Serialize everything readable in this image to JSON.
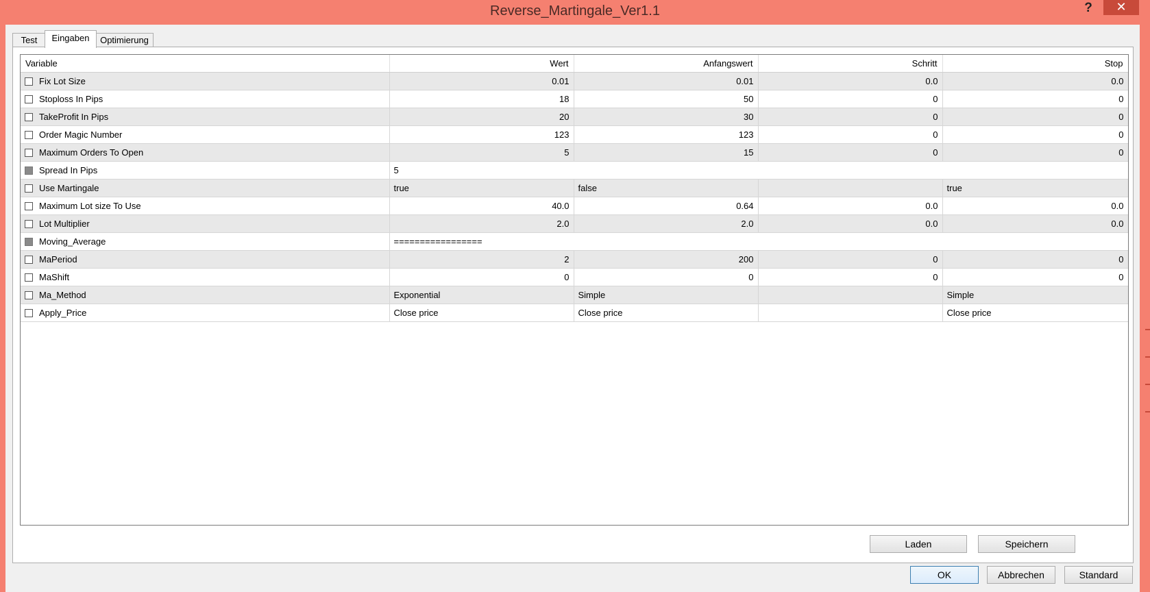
{
  "window": {
    "title": "Reverse_Martingale_Ver1.1",
    "help_label": "?",
    "close_label": "✕"
  },
  "tabs": [
    {
      "label": "Test",
      "active": false
    },
    {
      "label": "Eingaben",
      "active": true
    },
    {
      "label": "Optimierung",
      "active": false
    }
  ],
  "grid": {
    "headers": [
      "Variable",
      "Wert",
      "Anfangswert",
      "Schritt",
      "Stop"
    ],
    "rows": [
      {
        "name": "Fix Lot Size",
        "checked": false,
        "disabled": false,
        "wert": "0.01",
        "anfangswert": "0.01",
        "schritt": "0.0",
        "stop": "0.0"
      },
      {
        "name": "Stoploss In Pips",
        "checked": false,
        "disabled": false,
        "wert": "18",
        "anfangswert": "50",
        "schritt": "0",
        "stop": "0"
      },
      {
        "name": "TakeProfit In Pips",
        "checked": false,
        "disabled": false,
        "wert": "20",
        "anfangswert": "30",
        "schritt": "0",
        "stop": "0"
      },
      {
        "name": "Order Magic Number",
        "checked": false,
        "disabled": false,
        "wert": "123",
        "anfangswert": "123",
        "schritt": "0",
        "stop": "0"
      },
      {
        "name": "Maximum Orders To Open",
        "checked": false,
        "disabled": false,
        "wert": "5",
        "anfangswert": "15",
        "schritt": "0",
        "stop": "0"
      },
      {
        "name": "Spread In Pips",
        "checked": false,
        "disabled": true,
        "wert": "5",
        "span": true
      },
      {
        "name": "Use Martingale",
        "checked": false,
        "disabled": false,
        "wert": "true",
        "anfangswert": "false",
        "schritt": "",
        "stop": "true",
        "text": true
      },
      {
        "name": "Maximum Lot size To Use",
        "checked": false,
        "disabled": false,
        "wert": "40.0",
        "anfangswert": "0.64",
        "schritt": "0.0",
        "stop": "0.0"
      },
      {
        "name": "Lot Multiplier",
        "checked": false,
        "disabled": false,
        "wert": "2.0",
        "anfangswert": "2.0",
        "schritt": "0.0",
        "stop": "0.0"
      },
      {
        "name": "Moving_Average",
        "checked": false,
        "disabled": true,
        "wert": "=================",
        "span": true
      },
      {
        "name": "MaPeriod",
        "checked": false,
        "disabled": false,
        "wert": "2",
        "anfangswert": "200",
        "schritt": "0",
        "stop": "0"
      },
      {
        "name": "MaShift",
        "checked": false,
        "disabled": false,
        "wert": "0",
        "anfangswert": "0",
        "schritt": "0",
        "stop": "0"
      },
      {
        "name": "Ma_Method",
        "checked": false,
        "disabled": false,
        "wert": "Exponential",
        "anfangswert": "Simple",
        "schritt": "",
        "stop": "Simple",
        "text": true
      },
      {
        "name": "Apply_Price",
        "checked": false,
        "disabled": false,
        "wert": "Close price",
        "anfangswert": "Close price",
        "schritt": "",
        "stop": "Close price",
        "text": true
      }
    ]
  },
  "panel_buttons": {
    "load": "Laden",
    "save": "Speichern"
  },
  "dialog_buttons": {
    "ok": "OK",
    "cancel": "Abbrechen",
    "default": "Standard"
  }
}
